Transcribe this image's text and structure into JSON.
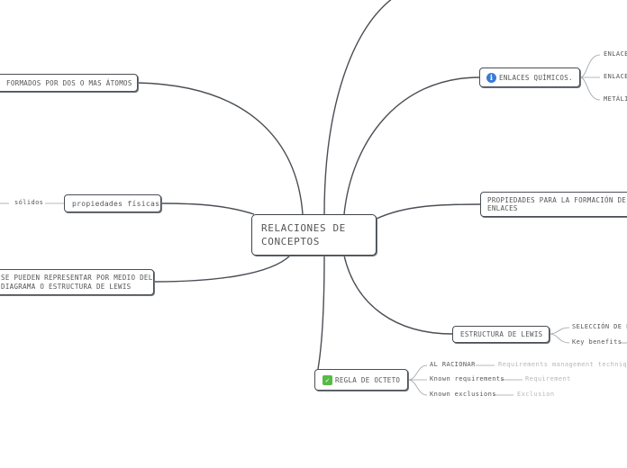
{
  "central": {
    "label": "RELACIONES DE CONCEPTOS"
  },
  "nodes": {
    "formados": "FORMADOS POR DOS O MAS ÁTOMOS",
    "propiedades_fisicas": "propiedades físicas",
    "lewis_repr": "SE PUEDEN REPRESENTAR POR MEDIO DEL DIAGRAMA O ESTRUCTURA DE LEWIS",
    "enlaces_quimicos": "ENLACES QUÍMICOS.",
    "propiedades_formacion": "PROPIEDADES PARA LA FORMACIÓN DE ENLACES",
    "estructura_lewis": "ESTRUCTURA DE LEWIS",
    "regla_octeto": "REGLA DE OCTETO"
  },
  "leaves": {
    "solidos": "sólidos",
    "enlace_1": "ENLACE",
    "enlace_2": "ENLACE",
    "metalico": "METÁLIC",
    "seleccion": "SELECCIÓN DE LA",
    "key_benefits": "Key benefits",
    "al_racionar": "AL RACIONAR",
    "requirements_mgmt": "Requirements management technique",
    "known_requirements": "Known requirements",
    "requirement": "Requirement",
    "known_exclusions": "Known exclusions",
    "exclusion": "Exclusion"
  },
  "icons": {
    "enlaces_quimicos": "info-icon",
    "regla_octeto": "checkmark-icon"
  },
  "colors": {
    "line": "#4a4f55",
    "leaf_line": "#9aa0a6",
    "faded_text": "#b8b8b8",
    "info_icon": "#3a7bd5",
    "check_icon": "#58b947"
  }
}
